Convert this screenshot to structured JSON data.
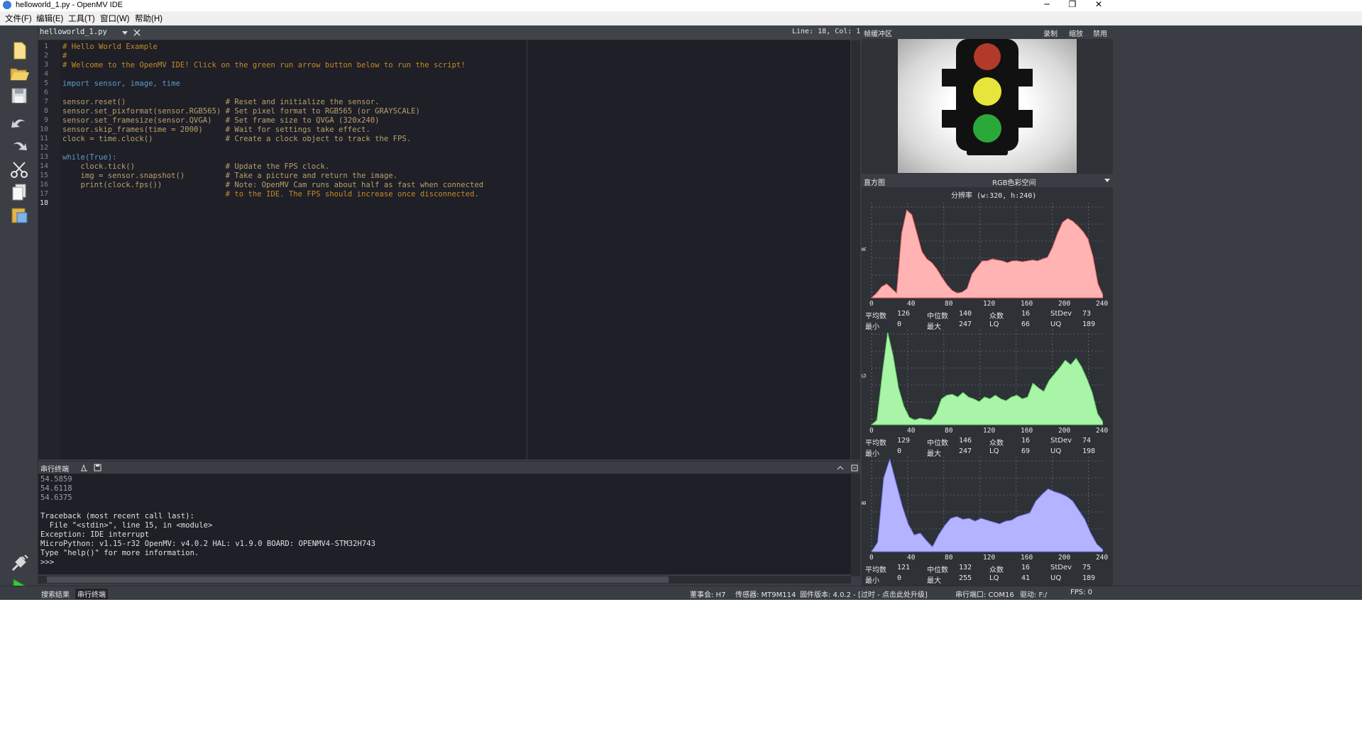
{
  "window": {
    "title": "helloworld_1.py - OpenMV IDE",
    "minimize": "─",
    "maximize": "❐",
    "close": "✕"
  },
  "menu": [
    "文件(F)",
    "编辑(E)",
    "工具(T)",
    "窗口(W)",
    "帮助(H)"
  ],
  "editor": {
    "tab_name": "helloworld_1.py",
    "cursor_position": "Line: 18, Col: 1",
    "line_numbers": [
      "1",
      "2",
      "3",
      "4",
      "5",
      "6",
      "7",
      "8",
      "9",
      "10",
      "11",
      "12",
      "13",
      "14",
      "15",
      "16",
      "17",
      "18"
    ],
    "code_lines": [
      "# Hello World Example",
      "#",
      "# Welcome to the OpenMV IDE! Click on the green run arrow button below to run the script!",
      "",
      "import sensor, image, time",
      "",
      "sensor.reset()                      # Reset and initialize the sensor.",
      "sensor.set_pixformat(sensor.RGB565) # Set pixel format to RGB565 (or GRAYSCALE)",
      "sensor.set_framesize(sensor.QVGA)   # Set frame size to QVGA (320x240)",
      "sensor.skip_frames(time = 2000)     # Wait for settings take effect.",
      "clock = time.clock()                # Create a clock object to track the FPS.",
      "",
      "while(True):",
      "    clock.tick()                    # Update the FPS clock.",
      "    img = sensor.snapshot()         # Take a picture and return the image.",
      "    print(clock.fps())              # Note: OpenMV Cam runs about half as fast when connected",
      "                                    # to the IDE. The FPS should increase once disconnected.",
      ""
    ]
  },
  "terminal": {
    "title": "串行终端",
    "lines": [
      "54.5859",
      "54.6118",
      "54.6375",
      "",
      "Traceback (most recent call last):",
      "  File \"<stdin>\", line 15, in <module>",
      "Exception: IDE interrupt",
      "MicroPython: v1.15-r32 OpenMV: v4.0.2 HAL: v1.9.0 BOARD: OPENMV4-STM32H743",
      "Type \"help()\" for more information.",
      ">>>"
    ]
  },
  "framebuffer": {
    "title": "帧缓冲区",
    "record": "录制",
    "zoom": "缩放",
    "disable": "禁用"
  },
  "histogram": {
    "title": "直方图",
    "color_space": "RGB色彩空间",
    "resolution": "分辨率 (w:320, h:240)",
    "x_ticks": [
      "0",
      "40",
      "80",
      "120",
      "160",
      "200",
      "240"
    ],
    "labels": {
      "mean": "平均数",
      "median": "中位数",
      "mode": "众数",
      "stdev": "StDev",
      "min": "最小",
      "max": "最大",
      "lq": "LQ",
      "uq": "UQ"
    },
    "channels": [
      {
        "name": "R",
        "color": "#ffb3b3",
        "stroke": "#ff6b6b",
        "mean": "126",
        "median": "140",
        "mode": "16",
        "stdev": "73",
        "min": "0",
        "max": "247",
        "lq": "66",
        "uq": "189"
      },
      {
        "name": "G",
        "color": "#a8f5a8",
        "stroke": "#5fd35f",
        "mean": "129",
        "median": "146",
        "mode": "16",
        "stdev": "74",
        "min": "0",
        "max": "247",
        "lq": "69",
        "uq": "198"
      },
      {
        "name": "B",
        "color": "#b3b3ff",
        "stroke": "#7b7bff",
        "mean": "121",
        "median": "132",
        "mode": "16",
        "stdev": "75",
        "min": "0",
        "max": "255",
        "lq": "41",
        "uq": "189"
      }
    ]
  },
  "statusbar": {
    "tabs": [
      "搜索结果",
      "串行终端"
    ],
    "board": "董事会: H7",
    "sensor": "传感器: MT9M114",
    "firmware": "固件版本: 4.0.2 - [过时 - 点击此处升级]",
    "port": "串行端口: COM16",
    "drive": "驱动: F:/",
    "fps": "FPS: 0"
  },
  "icons": [
    "new-file-icon",
    "open-file-icon",
    "save-icon",
    "undo-icon",
    "redo-icon",
    "cut-icon",
    "copy-icon",
    "paste-icon",
    "connect-icon",
    "run-icon"
  ]
}
